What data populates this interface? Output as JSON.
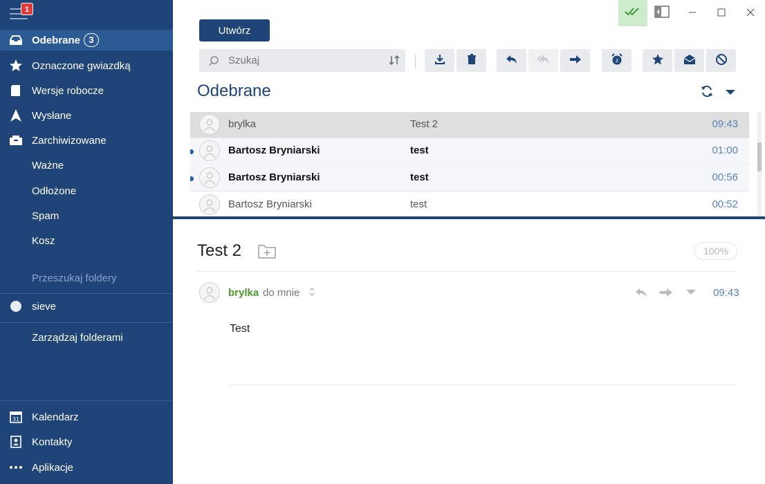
{
  "sidebar": {
    "notification_count": "1",
    "folders": [
      {
        "label": "Odebrane",
        "count": "3"
      },
      {
        "label": "Oznaczone gwiazdką"
      },
      {
        "label": "Wersje robocze"
      },
      {
        "label": "Wysłane"
      },
      {
        "label": "Zarchiwizowane"
      },
      {
        "label": "Ważne"
      },
      {
        "label": "Odłożone"
      },
      {
        "label": "Spam"
      },
      {
        "label": "Kosz"
      }
    ],
    "search_folders_label": "Przeszukaj foldery",
    "account_label": "sieve",
    "manage_folders_label": "Zarządzaj folderami",
    "bottom": [
      {
        "label": "Kalendarz"
      },
      {
        "label": "Kontakty"
      },
      {
        "label": "Aplikacje"
      }
    ]
  },
  "toolbar": {
    "create_label": "Utwórz",
    "search_placeholder": "Szukaj"
  },
  "list": {
    "title": "Odebrane",
    "messages": [
      {
        "from": "brylka",
        "subject": "Test 2",
        "time": "09:43",
        "state": "selected"
      },
      {
        "from": "Bartosz Bryniarski",
        "subject": "test",
        "time": "01:00",
        "state": "unread"
      },
      {
        "from": "Bartosz Bryniarski",
        "subject": "test",
        "time": "00:56",
        "state": "unread"
      },
      {
        "from": "Bartosz Bryniarski",
        "subject": "test",
        "time": "00:52",
        "state": "read"
      }
    ]
  },
  "preview": {
    "subject": "Test 2",
    "zoom": "100%",
    "sender": "brylka",
    "recipient": "do mnie",
    "time": "09:43",
    "body": "Test"
  },
  "colors": {
    "sidebar_bg": "#1f4477",
    "accent": "#1f4477",
    "sender_green": "#4a9a2a",
    "time_blue": "#5a82b5",
    "badge_red": "#e23b3b"
  }
}
